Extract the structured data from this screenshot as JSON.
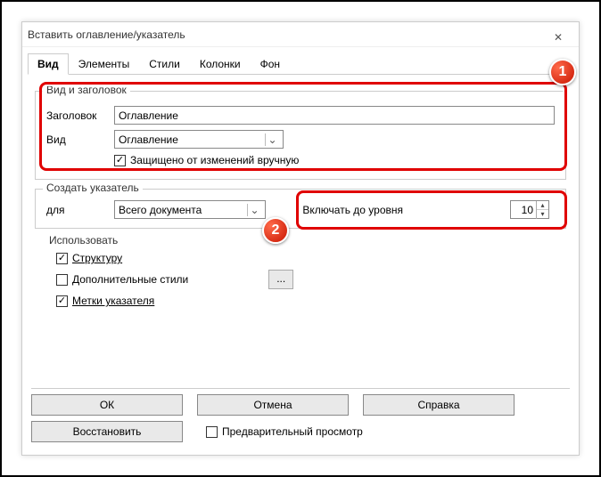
{
  "window": {
    "title": "Вставить оглавление/указатель"
  },
  "tabs": [
    "Вид",
    "Элементы",
    "Стили",
    "Колонки",
    "Фон"
  ],
  "group1": {
    "legend": "Вид и заголовок",
    "title_label": "Заголовок",
    "title_value": "Оглавление",
    "type_label": "Вид",
    "type_value": "Оглавление",
    "protect_label": "Защищено от изменений вручную"
  },
  "group2": {
    "legend": "Создать указатель",
    "for_label": "для",
    "for_value": "Всего документа",
    "level_label": "Включать до уровня",
    "level_value": "10"
  },
  "group3": {
    "legend": "Использовать",
    "structure": "Структуру",
    "styles": "Дополнительные стили",
    "marks": "Метки указателя"
  },
  "buttons": {
    "ok": "ОК",
    "cancel": "Отмена",
    "help": "Справка",
    "restore": "Восстановить",
    "preview": "Предварительный просмотр"
  },
  "callouts": {
    "one": "1",
    "two": "2"
  }
}
